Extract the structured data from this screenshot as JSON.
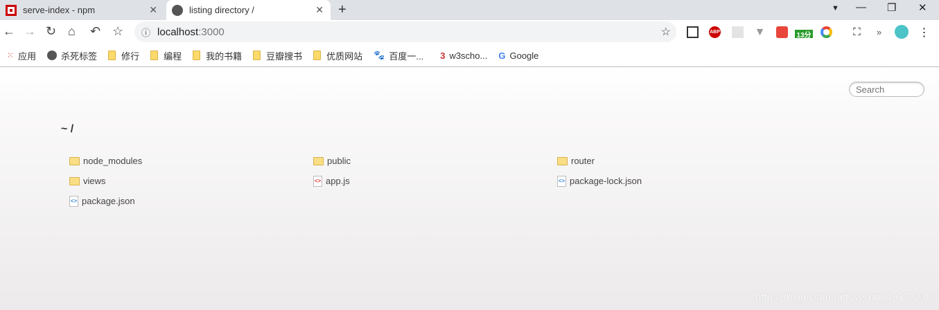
{
  "tabs": [
    {
      "title": "serve-index - npm",
      "active": false
    },
    {
      "title": "listing directory /",
      "active": true
    }
  ],
  "address": {
    "host": "localhost",
    "port": ":3000"
  },
  "extensions": {
    "abp": "ABP",
    "timer_badge": "13分"
  },
  "bookmarks": [
    {
      "label": "应用",
      "icon": "apps-grid-icon"
    },
    {
      "label": "杀死标签",
      "icon": "globe-icon"
    },
    {
      "label": "修行",
      "icon": "folder-icon"
    },
    {
      "label": "编程",
      "icon": "folder-icon"
    },
    {
      "label": "我的书籍",
      "icon": "folder-icon"
    },
    {
      "label": "豆瓣搜书",
      "icon": "folder-icon"
    },
    {
      "label": "优质网站",
      "icon": "folder-icon"
    },
    {
      "label": "百度一...",
      "icon": "baidu-paw-icon"
    },
    {
      "label": "w3scho...",
      "icon": "w3school-icon"
    },
    {
      "label": "Google",
      "icon": "google-icon"
    }
  ],
  "page": {
    "search_placeholder": "Search",
    "heading": "~ /",
    "files": [
      {
        "name": "node_modules",
        "type": "dir"
      },
      {
        "name": "public",
        "type": "dir"
      },
      {
        "name": "router",
        "type": "dir"
      },
      {
        "name": "views",
        "type": "dir"
      },
      {
        "name": "app.js",
        "type": "js"
      },
      {
        "name": "package-lock.json",
        "type": "json"
      },
      {
        "name": "package.json",
        "type": "json"
      }
    ]
  },
  "watermark": "https://blog.csdn.net/weixin_49379230"
}
